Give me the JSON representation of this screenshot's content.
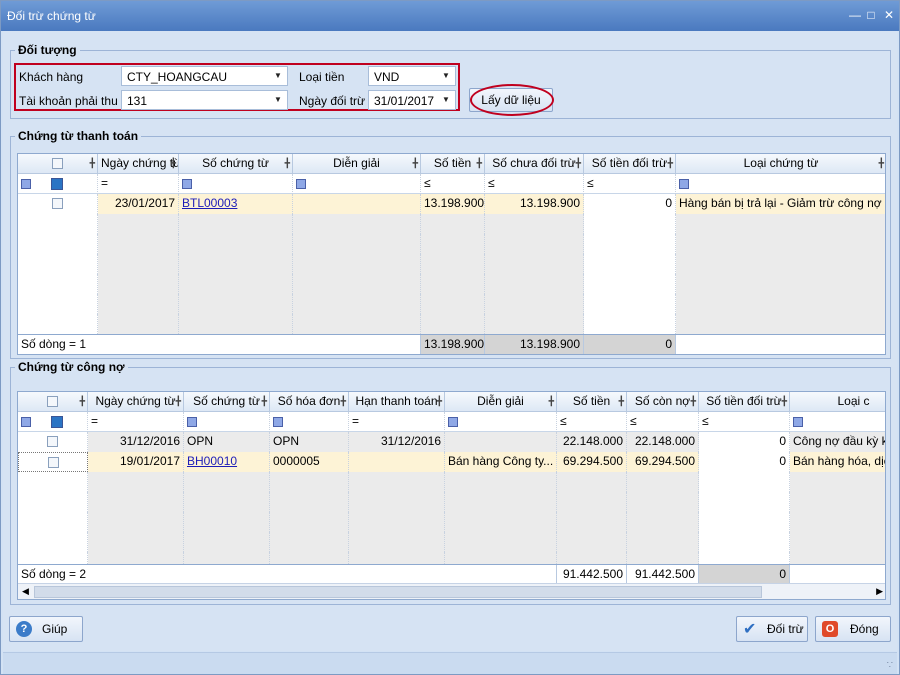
{
  "window": {
    "title": "Đối trừ chứng từ"
  },
  "doi_tuong": {
    "legend": "Đối tượng",
    "khach_hang_label": "Khách hàng",
    "khach_hang_value": "CTY_HOANGCAU",
    "loai_tien_label": "Loại tiền",
    "loai_tien_value": "VND",
    "tai_khoan_label": "Tài khoản phải thu",
    "tai_khoan_value": "131",
    "ngay_doi_tru_label": "Ngày đối trừ",
    "ngay_doi_tru_value": "31/01/2017",
    "lay_du_lieu_label": "Lấy dữ liệu"
  },
  "thanh_toan": {
    "legend": "Chứng từ thanh toán",
    "headers": [
      "Ngày chứng từ",
      "Số chứng từ",
      "Diễn giải",
      "Số tiền",
      "Số chưa đối trừ",
      "Số tiền đối trừ",
      "Loại chứng từ"
    ],
    "filter_ops": [
      "=",
      "",
      "",
      "≤",
      "≤",
      "≤",
      ""
    ],
    "rows": [
      {
        "ngay": "23/01/2017",
        "so_ct": "BTL00003",
        "dien_giai": "",
        "so_tien": "13.198.900",
        "so_chua": "13.198.900",
        "so_doi_tru": "0",
        "loai": "Hàng bán bị trả lại - Giảm trừ công nợ"
      }
    ],
    "footer": {
      "so_dong": "Số dòng = 1",
      "so_tien": "13.198.900",
      "so_chua": "13.198.900",
      "so_doi_tru": "0"
    }
  },
  "cong_no": {
    "legend": "Chứng từ công nợ",
    "headers": [
      "Ngày chứng từ",
      "Số chứng từ",
      "Số hóa đơn",
      "Hạn thanh toán",
      "Diễn giải",
      "Số tiền",
      "Số còn nợ",
      "Số tiền đối trừ",
      "Loại c"
    ],
    "filter_ops": [
      "=",
      "",
      "",
      "=",
      "",
      "≤",
      "≤",
      "≤",
      ""
    ],
    "rows": [
      {
        "ngay": "31/12/2016",
        "so_ct": "OPN",
        "so_hd": "OPN",
        "han": "31/12/2016",
        "dien_giai": "",
        "so_tien": "22.148.000",
        "con_no": "22.148.000",
        "doi_tru": "0",
        "loai": "Công nợ đầu kỳ khá"
      },
      {
        "ngay": "19/01/2017",
        "so_ct": "BH00010",
        "so_hd": "0000005",
        "han": "",
        "dien_giai": "Bán hàng Công ty...",
        "so_tien": "69.294.500",
        "con_no": "69.294.500",
        "doi_tru": "0",
        "loai": "Bán hàng hóa, dịch"
      }
    ],
    "footer": {
      "so_dong": "Số dòng = 2",
      "so_tien": "91.442.500",
      "con_no": "91.442.500",
      "doi_tru": "0"
    }
  },
  "buttons": {
    "giup": "Giúp",
    "doi_tru": "Đối trừ",
    "dong": "Đóng"
  },
  "colors": {
    "title_bar": "#4a79bf",
    "highlight": "#c0001e",
    "selected_row": "#fdf3d6"
  }
}
